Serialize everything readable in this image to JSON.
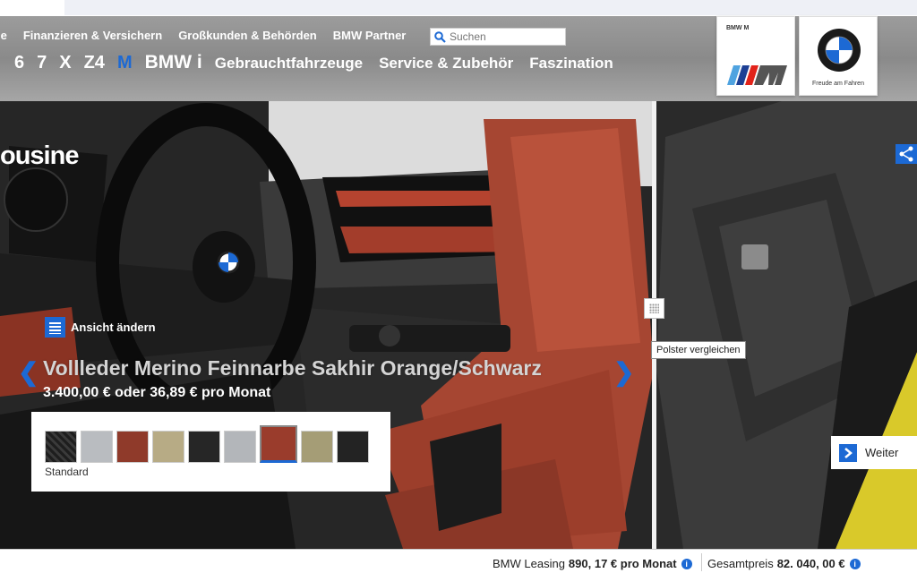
{
  "topnav": [
    {
      "label": "le"
    },
    {
      "label": "Finanzieren & Versichern"
    },
    {
      "label": "Großkunden & Behörden"
    },
    {
      "label": "BMW Partner"
    }
  ],
  "search": {
    "placeholder": "Suchen"
  },
  "mainnav": [
    {
      "label": "6"
    },
    {
      "label": "7"
    },
    {
      "label": "X"
    },
    {
      "label": "Z4"
    },
    {
      "label": "M"
    },
    {
      "label": "BMW i"
    },
    {
      "label": "Gebrauchtfahrzeuge"
    },
    {
      "label": "Service & Zubehör"
    },
    {
      "label": "Faszination"
    }
  ],
  "logos": {
    "bmw_m": "BMW M",
    "bmw_slogan": "Freude am Fahren"
  },
  "stage": {
    "title": "ousine",
    "change_view": "Ansicht ändern",
    "compare_tooltip": "Polster vergleichen",
    "upholstery_name": "Vollleder Merino Feinnarbe Sakhir Orange/Schwarz",
    "upholstery_price": "3.400,00 € oder 36,89 € pro Monat",
    "swatch_label": "Standard",
    "swatches": [
      {
        "color": "#2b2b2b",
        "selected": false
      },
      {
        "color": "#b9bcc0",
        "selected": false
      },
      {
        "color": "#8f3a2a",
        "selected": false
      },
      {
        "color": "#b7ab85",
        "selected": false
      },
      {
        "color": "#262626",
        "selected": false
      },
      {
        "color": "#b3b6ba",
        "selected": false
      },
      {
        "color": "#9a3c2c",
        "selected": true
      },
      {
        "color": "#a59d76",
        "selected": false
      },
      {
        "color": "#232323",
        "selected": false
      }
    ],
    "next_label": "Weiter"
  },
  "footer": {
    "leasing_label": "BMW Leasing",
    "leasing_value": "890, 17 € pro Monat",
    "total_label": "Gesamtpreis",
    "total_value": "82. 040, 00 €"
  },
  "colors": {
    "accent": "#1c69d4",
    "leather": "#a64632",
    "header": "#939393"
  }
}
